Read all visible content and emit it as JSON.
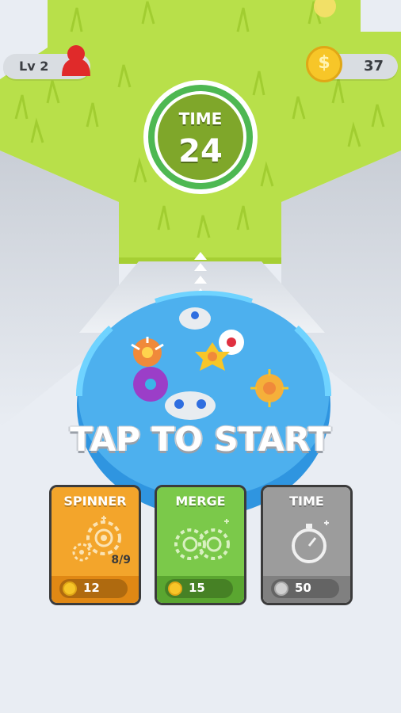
{
  "hud": {
    "level_label": "Lv 2",
    "coins": "37",
    "coin_symbol": "$"
  },
  "timer": {
    "label": "TIME",
    "value": "24"
  },
  "start_prompt": "TAP TO START",
  "cards": [
    {
      "title": "SPINNER",
      "progress": "8/9",
      "price": "12",
      "icon": "spinner-gears-icon"
    },
    {
      "title": "MERGE",
      "price": "15",
      "icon": "merge-gears-icon"
    },
    {
      "title": "TIME",
      "price": "50",
      "icon": "stopwatch-icon"
    }
  ],
  "colors": {
    "grass": "#b8e04a",
    "arena": "#4db0ee",
    "arena_rim": "#2f95e0",
    "spinner_card": "#f3a52b",
    "merge_card": "#7bc94a",
    "time_card": "#9c9c9c",
    "coin": "#f7c628"
  }
}
